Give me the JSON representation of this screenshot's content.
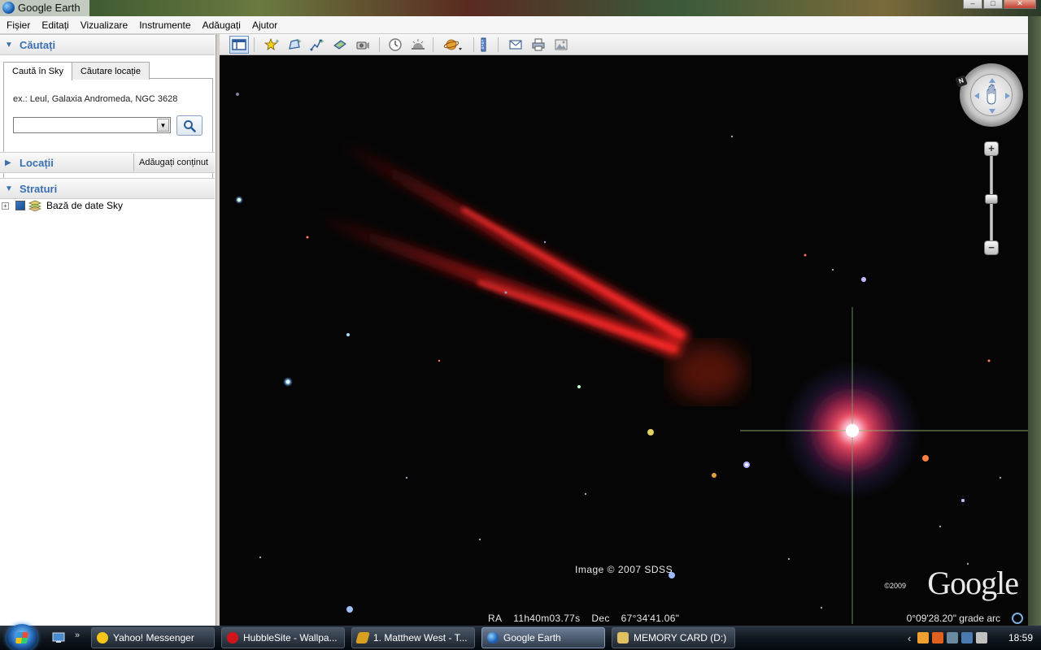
{
  "window": {
    "title": "Google Earth",
    "minimize_glyph": "–",
    "maximize_glyph": "□",
    "close_glyph": "✕"
  },
  "menu": [
    "Fișier",
    "Editați",
    "Vizualizare",
    "Instrumente",
    "Adăugați",
    "Ajutor"
  ],
  "left_panel": {
    "search": {
      "header": "Căutați",
      "tabs": [
        "Caută în Sky",
        "Căutare locație"
      ],
      "hint": "ex.: Leul, Galaxia Andromeda, NGC 3628",
      "input_value": "",
      "search_icon": "magnifier-icon"
    },
    "places": {
      "header": "Locații",
      "add_content": "Adăugați conținut"
    },
    "layers": {
      "header": "Straturi",
      "items": [
        {
          "label": "Bază de date Sky",
          "checked": true,
          "icon": "layers-icon"
        }
      ]
    }
  },
  "toolbar": {
    "buttons": [
      "sidebar-toggle",
      "placemark",
      "polygon",
      "path",
      "image-overlay",
      "record-tour",
      "historical-imagery",
      "sunlight",
      "planets",
      "ruler",
      "email",
      "print",
      "save-image"
    ],
    "active": "sidebar-toggle"
  },
  "map": {
    "credit": "Image © 2007 SDSS",
    "ra_label": "RA",
    "ra_value": "11h40m03.77s",
    "dec_label": "Dec",
    "dec_value": "67°34'41.06\"",
    "scale": "0°09'28.20\" grade arc",
    "logo_copyright": "©2009",
    "logo": "Google",
    "nav_north": "N",
    "zoom_in": "+",
    "zoom_out": "−",
    "accent_color": "#ff1a1a"
  },
  "taskbar": {
    "quicklaunch_more": "»",
    "tasks": [
      {
        "label": "Yahoo! Messenger",
        "icon": "yahoo-smiley-icon",
        "color": "#f5c518"
      },
      {
        "label": "HubbleSite - Wallpa...",
        "icon": "opera-icon",
        "color": "#d0141c"
      },
      {
        "label": "1. Matthew West - T...",
        "icon": "winamp-icon",
        "color": "#d8a020"
      },
      {
        "label": "Google Earth",
        "icon": "google-earth-icon",
        "color": "#2a70c0",
        "active": true
      },
      {
        "label": "MEMORY CARD (D:)",
        "icon": "folder-icon",
        "color": "#e0c060"
      }
    ],
    "tray_arrow": "‹",
    "clock": "18:59"
  }
}
